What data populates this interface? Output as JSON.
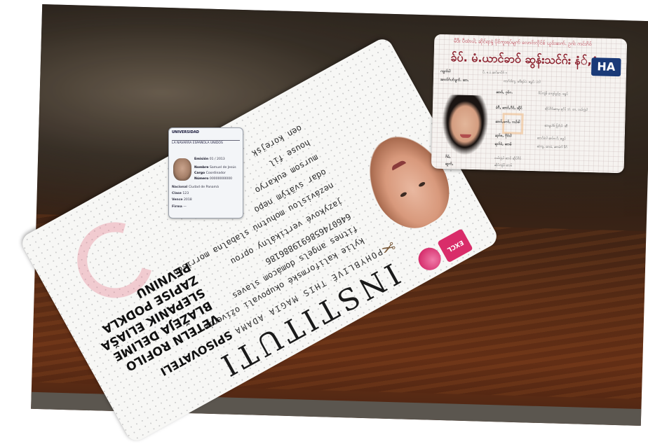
{
  "card": {
    "title": "INSTITUTI",
    "subtitle": "POHYBLIVÉ THIS MAGIA ADAMA",
    "heading": "SPISOVATELI",
    "lines": [
      "kylie kaliformské okupovali ožívenia",
      "fitnes angels domácom slaves",
      "6460746586919886186",
      "jazykové vertikálny oprou",
      "nezávislou mohutnú slabalnа morrison",
      "odar svätým nepo",
      "mursom eukaryo",
      "house fil",
      "oen korejsk"
    ],
    "name_block": "VETELN ROFILO BLAŽEJA DELIME SLEPANIK ELIAŠA ZAPISE PODKLA PEVNINU",
    "badge": "EXCL"
  },
  "mini_card": {
    "header": "UNIVERSIDAD",
    "header2": "LA NAVARRA ESPAÑOLA UNIDOS",
    "rows": [
      {
        "label": "Emisión",
        "value": "01 / 2013"
      },
      {
        "label": "Nombre",
        "value": "Samuel de Jesús"
      },
      {
        "label": "Cargo",
        "value": "Coordinador"
      },
      {
        "label": "Número",
        "value": "00000000000"
      }
    ],
    "lower": [
      {
        "label": "Nacional",
        "value": "Ciudad de Panamá"
      },
      {
        "label": "Clase",
        "value": "123"
      },
      {
        "label": "Vence",
        "value": "2018"
      },
      {
        "label": "Firma",
        "value": "—"
      }
    ]
  },
  "mm_card": {
    "top": "မီဒီး ပီထံာပါ, ဆိုင်ရာနှံ့ ပိုင်ကူးရပ်မျက် လောင်းလိုင်စ် ယူဝ်းဆက်. ဥဂါး ကင်းဂိဝ်",
    "title": "ခ်ပ်. မံ.ယာင်ခာဝ် ဆွန်းသင်ဂ်း နံ်,ခံ,",
    "logo": "HA",
    "fields": [
      {
        "label": "ကျက်ပါ",
        "value": "ပိ, မ.ပံ.ဆင်ဂေပိဒ် ၁"
      },
      {
        "label": "အာလ်ဂ်ပင်ပျက်. ဆာ.",
        "value": "ကာဂ်ဂါးဂျ. မဖီရပ်ပဲ. ဓမ္မပ်. ပဲဝါ"
      },
      {
        "label": "ဆာဝ်, ဂှဝ်ဂ.",
        "value": "ဖိပ်ကျဲမိ ကျော်ပွင့်ဥ. ဓမ္မပ်"
      },
      {
        "label": "ခံဂီ, ဆာဝ်,ဂိဝ်, ဆိုင်",
        "value": "ဆိုပ်ဂိဝ်ဆာမှ ရင်ပ် ဘဲ. ဂေ, ဝယ်ဂျဲပါ"
      },
      {
        "label": "ဆာဝ်,ဂေဝ်, ဝယ်ဖါ",
        "value": "ဆာမှုပါဝ် ပြင်ပါ. ဆီ"
      },
      {
        "label": "ဆုဂ်ဗ, ဂိုဝ်ပါ",
        "value": "ဆာင်ဗံဝါ ဆပ်ဗ.ပိ, ဓမ္မပ်"
      },
      {
        "label": "ရာဂ်ဝဲ, ဆာမ်",
        "value": "ဆဲကျ, ဆာမဲ, ဆာမံဂါ ဖိဂ်"
      },
      {
        "label": "ဂိမ်,",
        "value": "ဝယ်ဂျဲပါ ဆာဝ် ဆိုပ်ဂိဝ်"
      },
      {
        "label": "ဆူက်,",
        "value": "ဆိုပ်ကျဲမိ ဆာမ်"
      }
    ]
  }
}
